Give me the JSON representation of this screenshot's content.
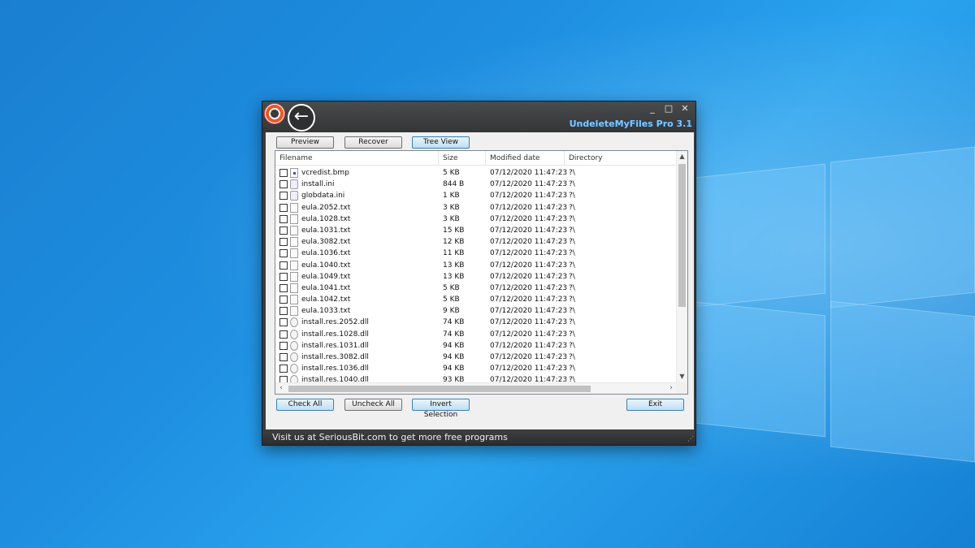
{
  "window": {
    "title": "UndeleteMyFiles Pro 3.1",
    "controls": {
      "minimize": "_",
      "maximize": "□",
      "close": "✕"
    },
    "back_icon": "←"
  },
  "toolbar": {
    "preview": "Preview",
    "recover": "Recover",
    "tree_view": "Tree View"
  },
  "table": {
    "columns": [
      "Filename",
      "Size",
      "Modified date",
      "Directory"
    ],
    "rows": [
      {
        "name": "vcredist.bmp",
        "size": "5 KB",
        "date": "07/12/2020 11:47:23",
        "dir": "?\\",
        "icon": "bmp-file-icon"
      },
      {
        "name": "install.ini",
        "size": "844 B",
        "date": "07/12/2020 11:47:23",
        "dir": "?\\",
        "icon": "ini-file-icon"
      },
      {
        "name": "globdata.ini",
        "size": "1 KB",
        "date": "07/12/2020 11:47:23",
        "dir": "?\\",
        "icon": "ini-file-icon"
      },
      {
        "name": "eula.2052.txt",
        "size": "3 KB",
        "date": "07/12/2020 11:47:23",
        "dir": "?\\",
        "icon": "txt-file-icon"
      },
      {
        "name": "eula.1028.txt",
        "size": "3 KB",
        "date": "07/12/2020 11:47:23",
        "dir": "?\\",
        "icon": "txt-file-icon"
      },
      {
        "name": "eula.1031.txt",
        "size": "15 KB",
        "date": "07/12/2020 11:47:23",
        "dir": "?\\",
        "icon": "txt-file-icon"
      },
      {
        "name": "eula.3082.txt",
        "size": "12 KB",
        "date": "07/12/2020 11:47:23",
        "dir": "?\\",
        "icon": "txt-file-icon"
      },
      {
        "name": "eula.1036.txt",
        "size": "11 KB",
        "date": "07/12/2020 11:47:23",
        "dir": "?\\",
        "icon": "txt-file-icon"
      },
      {
        "name": "eula.1040.txt",
        "size": "13 KB",
        "date": "07/12/2020 11:47:23",
        "dir": "?\\",
        "icon": "txt-file-icon"
      },
      {
        "name": "eula.1049.txt",
        "size": "13 KB",
        "date": "07/12/2020 11:47:23",
        "dir": "?\\",
        "icon": "txt-file-icon"
      },
      {
        "name": "eula.1041.txt",
        "size": "5 KB",
        "date": "07/12/2020 11:47:23",
        "dir": "?\\",
        "icon": "txt-file-icon"
      },
      {
        "name": "eula.1042.txt",
        "size": "5 KB",
        "date": "07/12/2020 11:47:23",
        "dir": "?\\",
        "icon": "txt-file-icon"
      },
      {
        "name": "eula.1033.txt",
        "size": "9 KB",
        "date": "07/12/2020 11:47:23",
        "dir": "?\\",
        "icon": "txt-file-icon"
      },
      {
        "name": "install.res.2052.dll",
        "size": "74 KB",
        "date": "07/12/2020 11:47:23",
        "dir": "?\\",
        "icon": "dll-file-icon"
      },
      {
        "name": "install.res.1028.dll",
        "size": "74 KB",
        "date": "07/12/2020 11:47:23",
        "dir": "?\\",
        "icon": "dll-file-icon"
      },
      {
        "name": "install.res.1031.dll",
        "size": "94 KB",
        "date": "07/12/2020 11:47:23",
        "dir": "?\\",
        "icon": "dll-file-icon"
      },
      {
        "name": "install.res.3082.dll",
        "size": "94 KB",
        "date": "07/12/2020 11:47:23",
        "dir": "?\\",
        "icon": "dll-file-icon"
      },
      {
        "name": "install.res.1036.dll",
        "size": "94 KB",
        "date": "07/12/2020 11:47:23",
        "dir": "?\\",
        "icon": "dll-file-icon"
      },
      {
        "name": "install.res.1040.dll",
        "size": "93 KB",
        "date": "07/12/2020 11:47:23",
        "dir": "?\\",
        "icon": "dll-file-icon"
      }
    ]
  },
  "bottom_buttons": {
    "check_all": "Check All",
    "uncheck_all": "Uncheck All",
    "invert_selection": "Invert Selection",
    "exit": "Exit"
  },
  "status": {
    "text": "Visit us at SeriousBit.com to get more free programs"
  }
}
